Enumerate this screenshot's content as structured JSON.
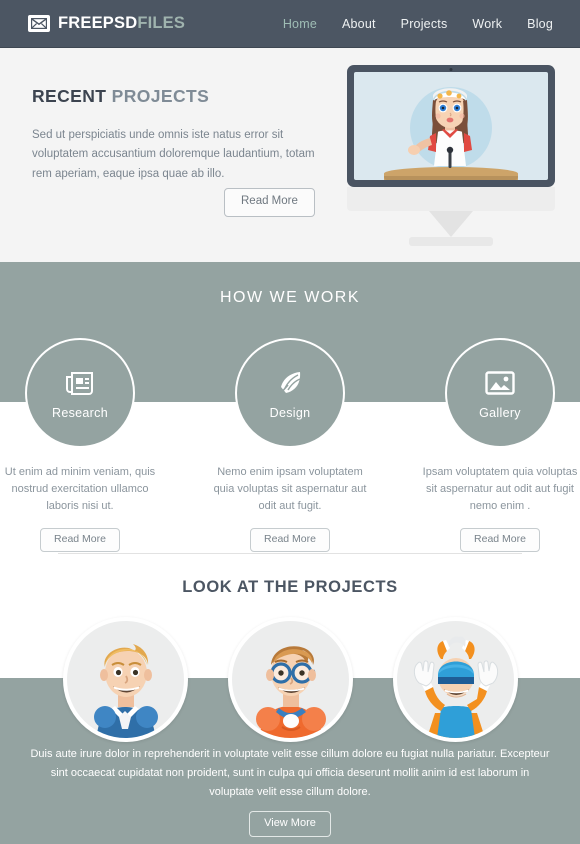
{
  "header": {
    "logo": {
      "icon": "envelope-icon",
      "part1": "FREEPSD",
      "part2": "FILES"
    },
    "nav": [
      {
        "label": "Home",
        "active": true
      },
      {
        "label": "About",
        "active": false
      },
      {
        "label": "Projects",
        "active": false
      },
      {
        "label": "Work",
        "active": false
      },
      {
        "label": "Blog",
        "active": false
      }
    ]
  },
  "hero": {
    "title_part1": "RECENT",
    "title_part2": "PROJECTS",
    "copy": "Sed ut perspiciatis unde omnis iste natus error sit voluptatem accusantium doloremque laudantium, totam rem aperiam, eaque ipsa quae ab illo.",
    "button": "Read More",
    "image": "desktop-monitor-with-cartoon-girl"
  },
  "work": {
    "title": "HOW WE WORK",
    "cards": [
      {
        "icon": "newspaper-icon",
        "label": "Research",
        "copy": "Ut enim ad minim veniam, quis nostrud exercitation ullamco laboris nisi ut.",
        "button": "Read More"
      },
      {
        "icon": "pen-feather-icon",
        "label": "Design",
        "copy": "Nemo enim ipsam voluptatem quia voluptas sit aspernatur aut odit aut fugit.",
        "button": "Read More"
      },
      {
        "icon": "image-picture-icon",
        "label": "Gallery",
        "copy": "Ipsam voluptatem quia voluptas sit aspernatur aut odit aut fugit nemo enim .",
        "button": "Read More"
      }
    ]
  },
  "projects": {
    "title": "LOOK AT THE PROJECTS",
    "avatars": [
      {
        "name": "blonde-hero-avatar"
      },
      {
        "name": "glasses-hero-avatar"
      },
      {
        "name": "masked-hero-avatar"
      }
    ],
    "copy": "Duis aute irure dolor in reprehenderit in voluptate velit esse cillum dolore eu fugiat nulla pariatur. Excepteur sint occaecat cupidatat non proident, sunt in culpa qui officia deserunt mollit anim id est laborum  in voluptate velit esse cillum dolore.",
    "button": "View More"
  },
  "colors": {
    "header_bg": "#4c5663",
    "hero_bg": "#f4f4f4",
    "sage": "#94a3a1",
    "accent_text": "#9fb3ae",
    "dark_text": "#4c5663",
    "muted_text": "#7b858f"
  }
}
